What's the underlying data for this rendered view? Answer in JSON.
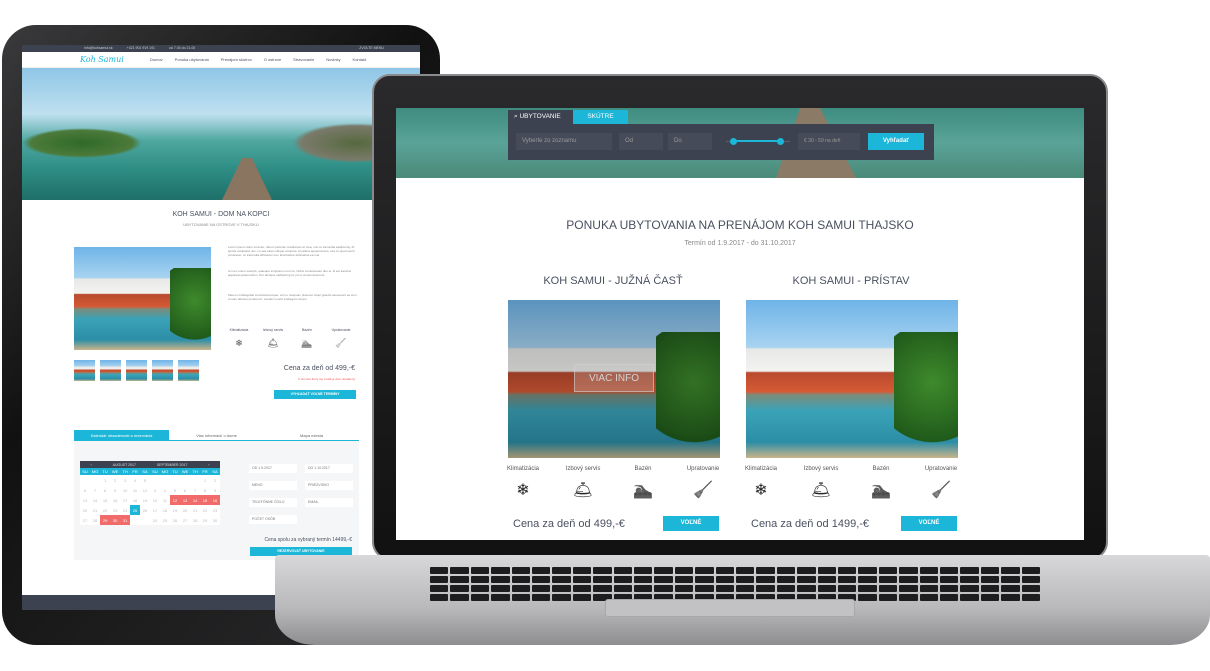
{
  "tablet": {
    "topbar": {
      "email": "info@kohsamui.sk",
      "phone1": "+421 901 919 191",
      "hours": "od 7.00 do 21.00",
      "currency": "ZVOLTE MENU"
    },
    "logo": "Koh Samui",
    "nav": [
      "Domov",
      "Ponuka ubytovania",
      "Prenájom skútrov",
      "O ostrove",
      "Stravovanie",
      "Novinky",
      "Kontakt"
    ],
    "title": "KOH SAMUI - DOM NA KOPCI",
    "subtitle": "UBYTOVANIE NA OSTROVE V THAJSKU",
    "paragraphs": [
      "Lorem ipsum dolor sit amet, rebum pertinax mandamus at mea, mei cu iracundia sadipscing. At ignota voluptaria nec, cu sea etiam ubique voluptua. An altera appareat duo, sed cu quod everti prodesset, cu iracundia efficiantur usu. Erat labore definiebas ea mei.",
      "An nec unum suscipit, quaeque scriptorem eum te. Nobis consectetuer duo ei, id est sanctus appareat quaerendum. Per denique sadipscing id, pri ut omnes deserunt.",
      "Mea cu intellegebat conclusionemque, vel ne nusquam placerat. Atqui graecis assueverit ea cum, ut eam labores ponderum. Laudem everti intellegam ad qui."
    ],
    "amenities": [
      "Klimatizácia",
      "Izbový servis",
      "Bazén",
      "Upratovanie"
    ],
    "price": "Cena za deň od 499,-€",
    "price_note": "V termíne ktorý ste zvolili je dom obsadený",
    "find_button": "VYHĽADAŤ VOĽNÉ TERMÍNY",
    "tabs": [
      "Kalendár obsadenosti a rezervácia",
      "Viac informácií o dome",
      "Mapa miesta"
    ],
    "calendar": {
      "month1": "AUGUST 2017",
      "month2": "SEPTEMBER 2017",
      "weekdays": [
        "SU",
        "MO",
        "TU",
        "WE",
        "TH",
        "FR",
        "SA",
        "SU",
        "MO",
        "TU",
        "WE",
        "TH",
        "FR",
        "SA"
      ],
      "rows": [
        [
          "",
          "",
          "1",
          "2",
          "3",
          "4",
          "5",
          "",
          "",
          "",
          "",
          "",
          "1",
          "2"
        ],
        [
          "6",
          "7",
          "8",
          "9",
          "10",
          "11",
          "12",
          "3",
          "4",
          "5",
          "6",
          "7",
          "8",
          "9"
        ],
        [
          "13",
          "14",
          "15",
          "16",
          "17",
          "18",
          "19",
          "10",
          "11",
          "12",
          "13",
          "14",
          "15",
          "16"
        ],
        [
          "20",
          "21",
          "22",
          "23",
          "24",
          "25",
          "26",
          "17",
          "18",
          "19",
          "20",
          "21",
          "22",
          "23"
        ],
        [
          "27",
          "28",
          "29",
          "30",
          "31",
          "",
          "",
          "24",
          "25",
          "26",
          "27",
          "28",
          "29",
          "30"
        ]
      ],
      "selected": "25",
      "booked_color": "#f26b6b"
    },
    "form": {
      "from": "OD 1.9.2017",
      "to": "DO 1.10.2017",
      "name": "MENO",
      "surname": "PRIEZVISKO",
      "phone": "TELEFÓNNE ČÍSLO",
      "email": "EMAIL",
      "persons": "POČET OSÔB"
    },
    "total": "Cena spolu za vybraný termín 14499,-€",
    "reserve_button": "REZERVOVAŤ UBYTOVANIE"
  },
  "laptop": {
    "search": {
      "tab_active": "UBYTOVANIE",
      "tab_other": "SKÚTRE",
      "select_placeholder": "Vyberte zo zoznamu",
      "from_placeholder": "Od",
      "to_placeholder": "Do",
      "price_range": "€ 30 - 59 na deň",
      "search_button": "Vyhľadať"
    },
    "title": "PONUKA UBYTOVANIA NA PRENÁJOM KOH SAMUI THAJSKO",
    "term": "Termín od 1.9.2017 - do 31.10.2017",
    "cards": [
      {
        "title": "KOH SAMUI - JUŽNÁ ČASŤ",
        "overlay": "VIAC INFO",
        "price": "Cena za deň od 499,-€",
        "button": "VOĽNÉ"
      },
      {
        "title": "KOH SAMUI - PRÍSTAV",
        "price": "Cena za deň od 1499,-€",
        "button": "VOĽNÉ"
      }
    ],
    "amenities": [
      "Klimatizácia",
      "Izbový servis",
      "Bazén",
      "Upratovanie"
    ]
  },
  "colors": {
    "accent": "#1cb6d8",
    "dark": "#3c4250",
    "booked": "#f26b6b"
  },
  "icons": [
    "air-conditioner-icon",
    "room-service-icon",
    "swimming-icon",
    "cleaning-icon",
    "search-icon"
  ]
}
